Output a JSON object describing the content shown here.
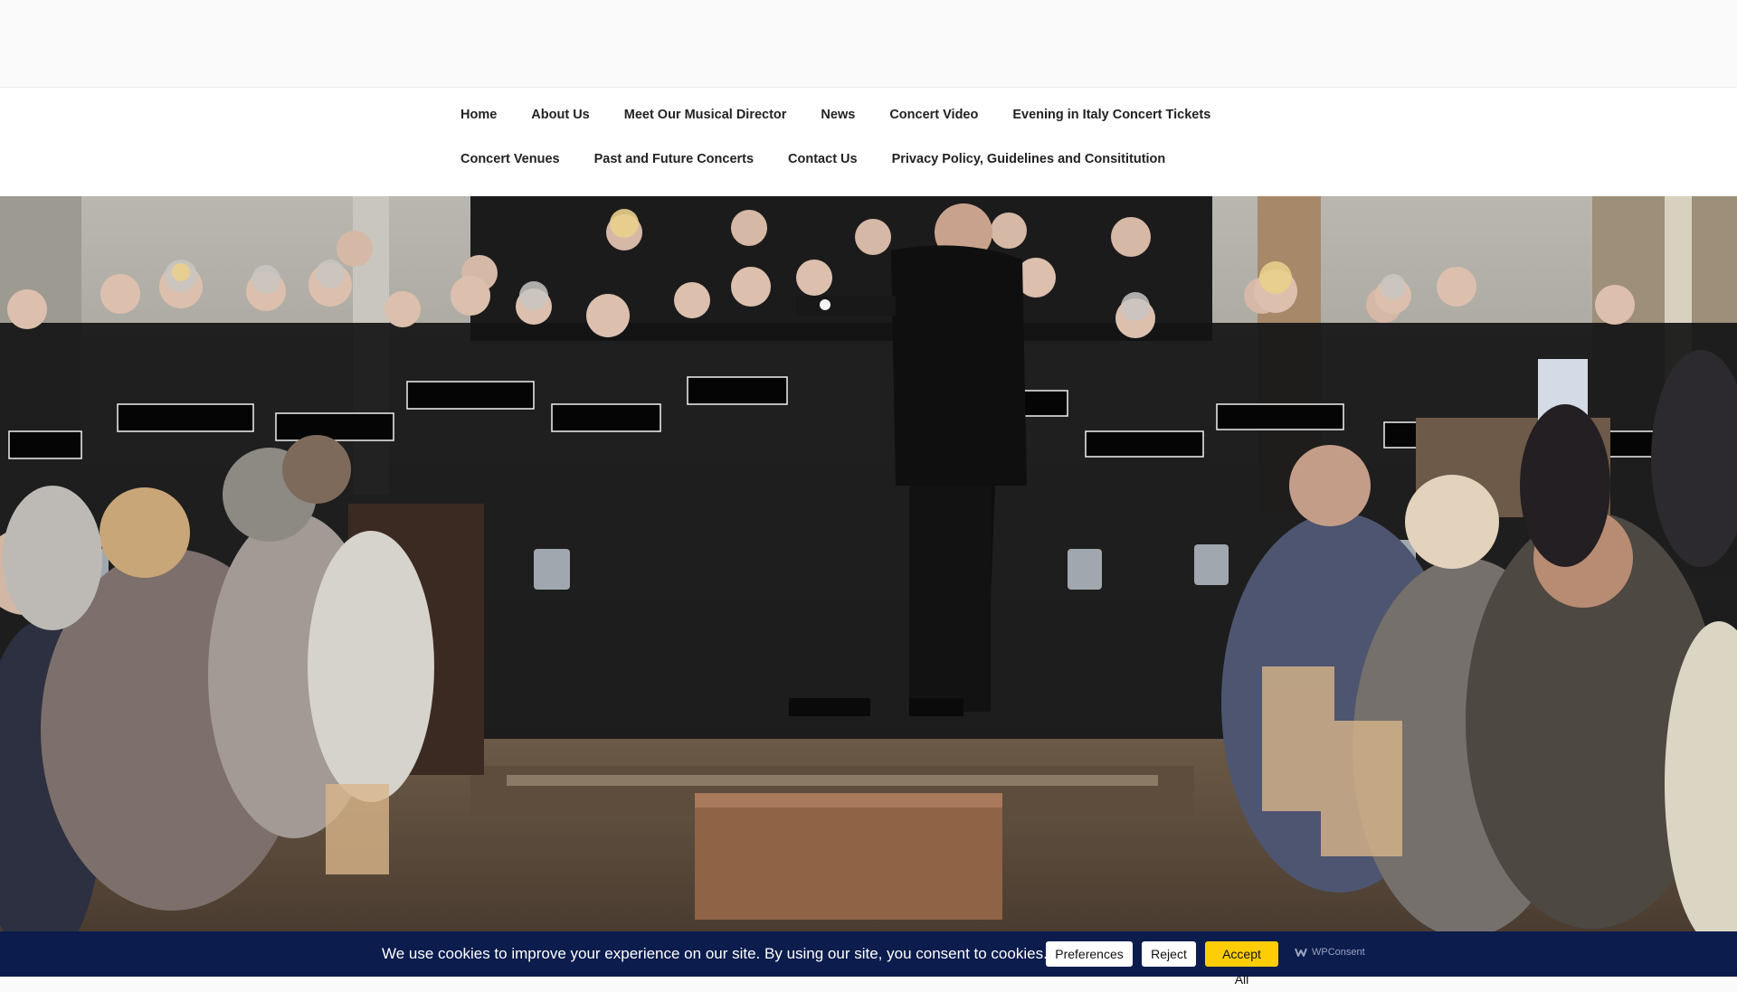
{
  "nav": {
    "row1": [
      "Home",
      "About Us",
      "Meet Our Musical Director",
      "News",
      "Concert Video",
      "Evening in Italy Concert Tickets"
    ],
    "row2": [
      "Concert Venues",
      "Past and Future Concerts",
      "Contact Us",
      "Privacy Policy, Guidelines and Consititution"
    ]
  },
  "cookie": {
    "message": "We use cookies to improve your experience on our site. By using our site, you consent to cookies.",
    "preferences": "Preferences",
    "reject": "Reject",
    "accept_all": "Accept All",
    "brand": "WPConsent",
    "brand_icon": "wpconsent-logo-icon",
    "accept_color": "#ffcd06",
    "bar_color": "#0b1c4d"
  }
}
